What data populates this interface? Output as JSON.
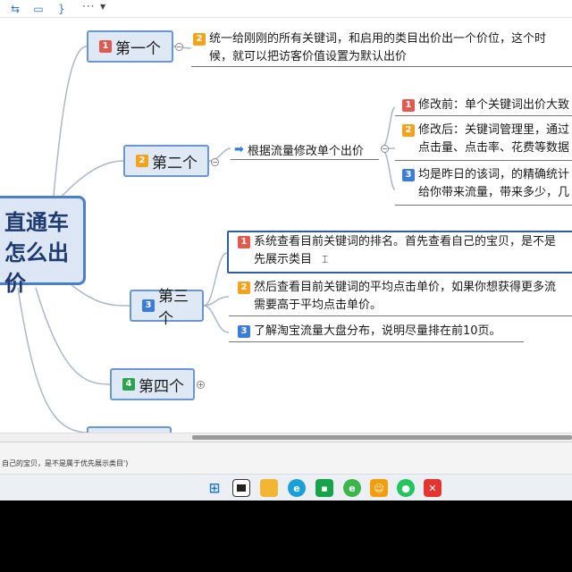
{
  "central": {
    "text": "直通车\n怎么出价"
  },
  "topics": [
    {
      "badge": "1",
      "label": "第一个"
    },
    {
      "badge": "2",
      "label": "第二个"
    },
    {
      "badge": "3",
      "label": "第三个"
    },
    {
      "badge": "4",
      "label": "第四个"
    }
  ],
  "topic1_detail": {
    "badge": "2",
    "line1": "统一给刚刚的所有关键词，和启用的类目出价出一个价位，这个时",
    "line2": "候，就可以把访客价值设置为默认出价"
  },
  "topic2_arrow": "根据流量修改单个出价",
  "topic2_items": [
    {
      "badge": "1",
      "line1": "修改前：单个关键词出价大致",
      "line2": ""
    },
    {
      "badge": "2",
      "line1": "修改后：关键词管理里，通过",
      "line2": "点击量、点击率、花费等数据"
    },
    {
      "badge": "3",
      "line1": "均是昨日的该词，的精确统计",
      "line2": "给你带来流量，带来多少，几"
    }
  ],
  "topic3_items": [
    {
      "badge": "1",
      "line1": "系统查看目前关键词的排名。首先查看自己的宝贝，是不是",
      "line2": "先展示类目"
    },
    {
      "badge": "2",
      "line1": "然后查看目前关键词的平均点击单价，如果你想获得更多流",
      "line2": "需要高于平均点击单价。"
    },
    {
      "badge": "3",
      "line1": "了解淘宝流量大盘分布，说明尽量排在前10页。",
      "line2": ""
    }
  ],
  "status_text": "自己的宝贝，是不是属于优先展示类目')",
  "colors": {
    "topic_border": "#6a96d4",
    "topic_fill": "#dfe8f5",
    "central_border": "#4a7fcd",
    "highlight": "#2e5ca8"
  },
  "icons": [
    "relationship-icon",
    "boundary-icon",
    "summary-icon",
    "more-icon",
    "windows-start-icon",
    "task-view-icon",
    "file-explorer-icon",
    "edge-icon",
    "store-icon",
    "browser-icon",
    "app-icon",
    "wechat-icon",
    "xmind-icon"
  ]
}
